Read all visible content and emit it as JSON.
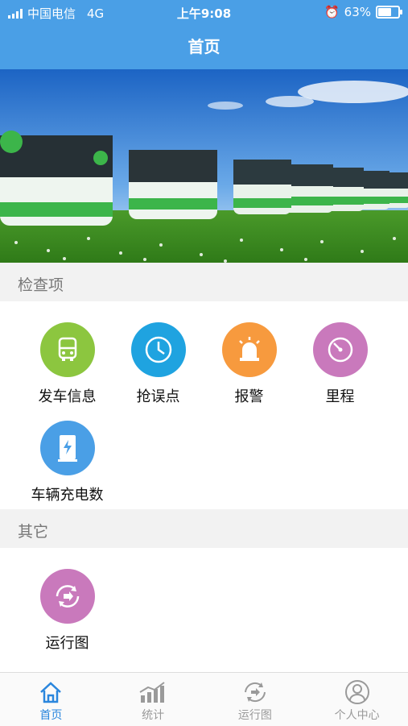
{
  "status_bar": {
    "carrier": "中国电信",
    "network": "4G",
    "time": "上午9:08",
    "battery": "63%"
  },
  "header": {
    "title": "首页"
  },
  "sections": [
    {
      "title": "检查项",
      "items": [
        {
          "label": "发车信息",
          "icon": "bus-icon",
          "color": "#8cc63f"
        },
        {
          "label": "抢误点",
          "icon": "clock-icon",
          "color": "#1fa3e0"
        },
        {
          "label": "报警",
          "icon": "alarm-light-icon",
          "color": "#f79a3e"
        },
        {
          "label": "里程",
          "icon": "odometer-icon",
          "color": "#c979bc"
        },
        {
          "label": "车辆充电数",
          "icon": "charging-station-icon",
          "color": "#4a9fe6"
        }
      ]
    },
    {
      "title": "其它",
      "items": [
        {
          "label": "运行图",
          "icon": "route-cycle-icon",
          "color": "#c979bc"
        }
      ]
    }
  ],
  "tabbar": [
    {
      "label": "首页",
      "icon": "home-icon",
      "active": true
    },
    {
      "label": "统计",
      "icon": "statistics-icon",
      "active": false
    },
    {
      "label": "运行图",
      "icon": "route-icon",
      "active": false
    },
    {
      "label": "个人中心",
      "icon": "user-icon",
      "active": false
    }
  ],
  "colors": {
    "primary": "#4a9fe6",
    "tab_active": "#2a86dd"
  }
}
